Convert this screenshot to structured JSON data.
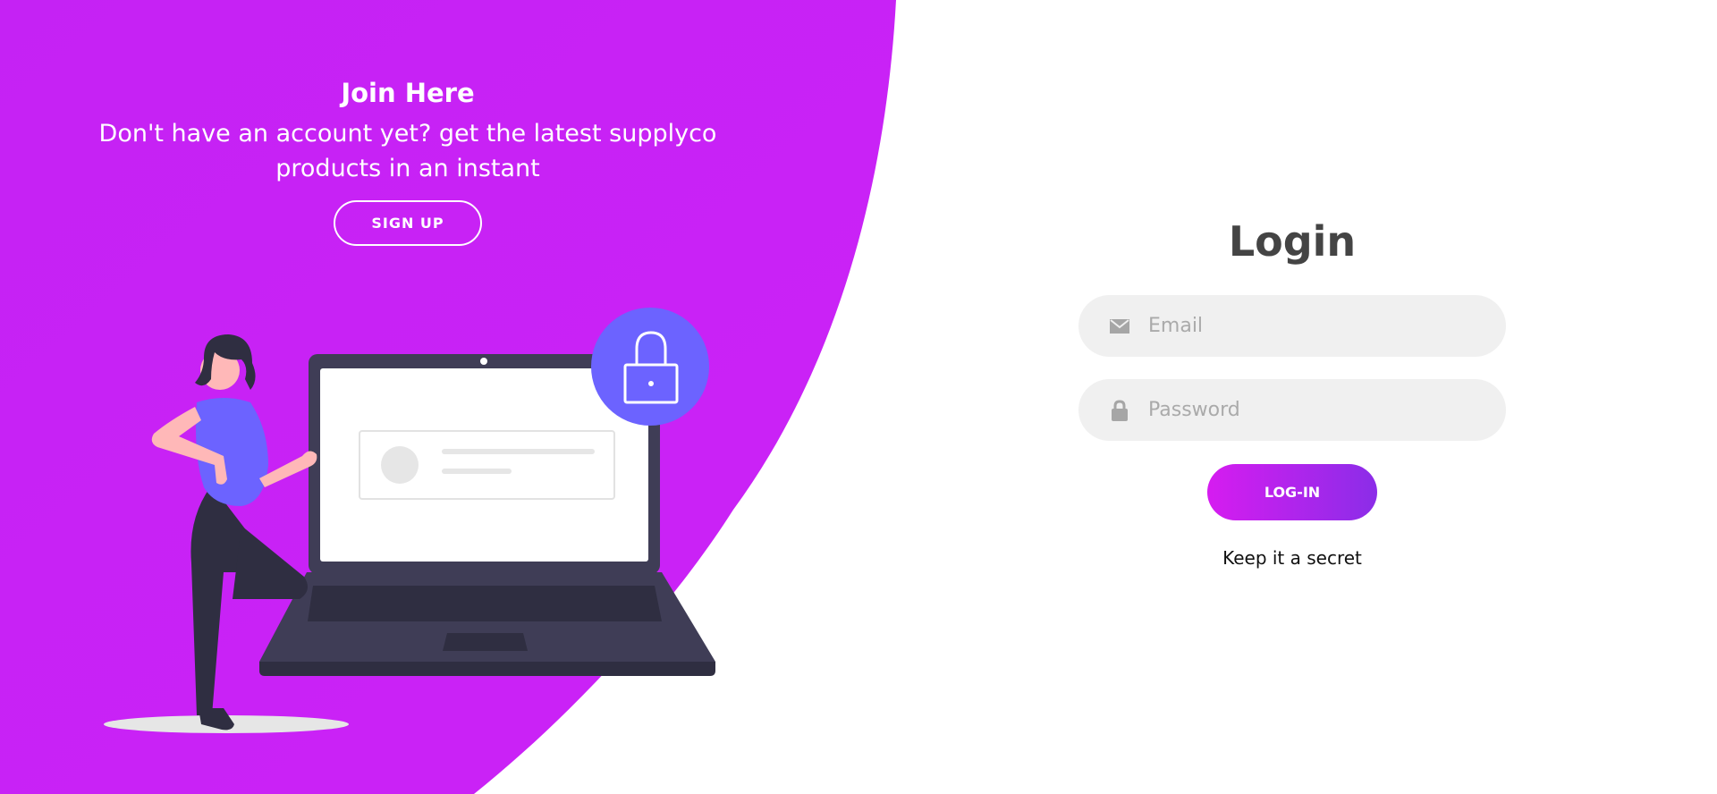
{
  "colors": {
    "brand_purple": "#c822f5",
    "button_gradient_start": "#d61cf0",
    "button_gradient_end": "#8b2de8",
    "input_background": "#f0f0f0",
    "heading_dark": "#444444"
  },
  "join": {
    "title": "Join Here",
    "text": "Don't have an account yet? get the latest supplyco products in an instant",
    "signup_label": "SIGN UP"
  },
  "login": {
    "title": "Login",
    "email": {
      "placeholder": "Email",
      "value": "",
      "icon": "envelope-icon"
    },
    "password": {
      "placeholder": "Password",
      "value": "",
      "icon": "lock-icon"
    },
    "submit_label": "LOG-IN",
    "footer_text": "Keep it a secret"
  },
  "illustration": {
    "icon": "woman-with-laptop-and-lock-illustration"
  }
}
